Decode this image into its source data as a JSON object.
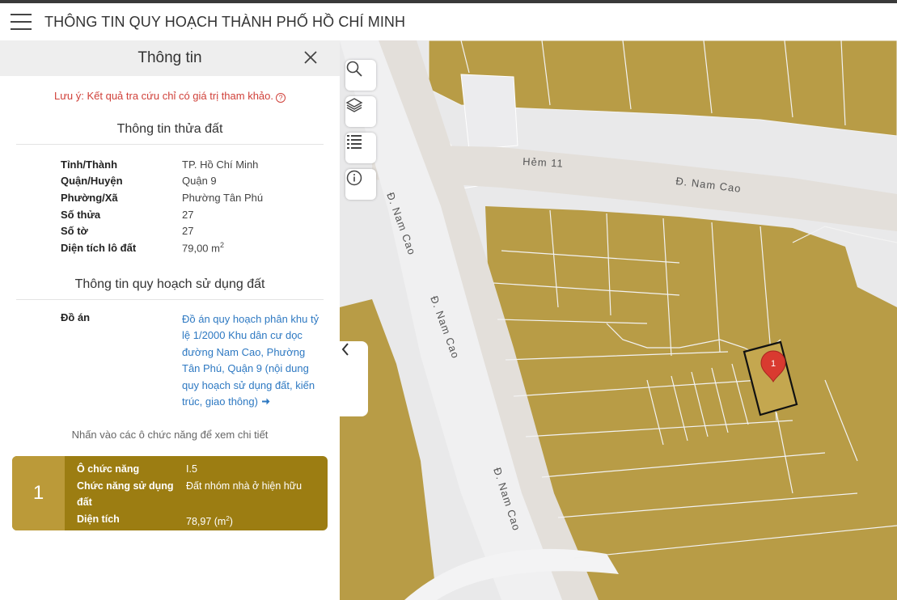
{
  "header": {
    "title": "THÔNG TIN QUY HOẠCH THÀNH PHỐ HỒ CHÍ MINH"
  },
  "panel": {
    "title": "Thông tin",
    "notice": "Lưu ý: Kết quả tra cứu chỉ có giá trị tham khảo.",
    "notice_icon": "?",
    "land_section_title": "Thông tin thửa đất",
    "land_info": [
      {
        "key": "Tỉnh/Thành",
        "value": "TP. Hồ Chí Minh"
      },
      {
        "key": "Quận/Huyện",
        "value": "Quận 9"
      },
      {
        "key": "Phường/Xã",
        "value": "Phường Tân Phú"
      },
      {
        "key": "Số thửa",
        "value": "27"
      },
      {
        "key": "Số tờ",
        "value": "27"
      },
      {
        "key": "Diện tích lô đất",
        "value": "79,00 m",
        "sup": "2"
      }
    ],
    "plan_section_title": "Thông tin quy hoạch sử dụng đất",
    "plan_key": "Đồ án",
    "plan_value": "Đồ án quy hoạch phân khu tỷ lệ 1/2000 Khu dân cư dọc đường Nam Cao, Phường Tân Phú, Quận 9 (nội dung quy hoạch sử dụng đất, kiến trúc, giao thông)",
    "hint": "Nhấn vào các ô chức năng để xem chi tiết",
    "function_card": {
      "number": "1",
      "rows": [
        {
          "key": "Ô chức năng",
          "value": "I.5"
        },
        {
          "key": "Chức năng sử dụng đất",
          "value": "Đất nhóm nhà ở hiện hữu"
        },
        {
          "key": "Diện tích",
          "value": "78,97 (m",
          "sup": "2",
          "suffix": ")"
        }
      ]
    }
  },
  "map": {
    "labels": {
      "hem11": "Hẻm 11",
      "nam_cao_a": "Đ. Nam Cao",
      "nam_cao_b": "Đ. Nam Cao",
      "nam_cao_c": "Đ. Nam Cao",
      "nam_cao_d": "Đ. Nam Cao"
    },
    "marker_label": "1",
    "tools": [
      "search-icon",
      "layers-icon",
      "list-icon",
      "info-icon"
    ],
    "colors": {
      "parcel": "#b89c46",
      "road": "#e3dfda",
      "background": "#e9e9ea",
      "marker": "#d93a30",
      "selection": "#111111"
    }
  }
}
